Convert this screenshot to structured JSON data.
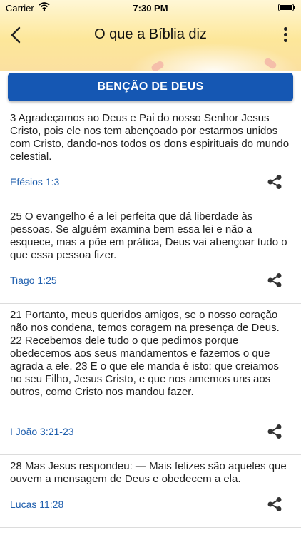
{
  "status_bar": {
    "carrier": "Carrier",
    "time": "7:30 PM"
  },
  "nav": {
    "title": "O que a Bíblia diz"
  },
  "section": {
    "label": "BENÇÃO DE DEUS"
  },
  "verses": [
    {
      "text": "3 Agradeçamos ao Deus e Pai do nosso Senhor Jesus Cristo, pois ele nos tem abençoado por estarmos unidos com Cristo, dando-nos todos os dons espirituais do mundo celestial.",
      "reference": "Efésios 1:3"
    },
    {
      "text": "25 O evangelho é a lei perfeita que dá liberdade às pessoas. Se alguém examina bem essa lei e não a esquece, mas a põe em prática, Deus vai abençoar tudo o que essa pessoa fizer.",
      "reference": "Tiago 1:25"
    },
    {
      "text": "21 Portanto, meus queridos amigos, se o nosso coração não nos condena, temos coragem na presença de Deus. 22 Recebemos dele tudo o que pedimos porque obedecemos aos seus mandamentos e fazemos o que agrada a ele. 23 E o que ele manda é isto: que creiamos no seu Filho, Jesus Cristo, e que nos amemos uns aos outros, como Cristo nos mandou fazer.",
      "reference": "I João 3:21-23"
    },
    {
      "text": "28 Mas Jesus respondeu: — Mais felizes são aqueles que ouvem a mensagem de Deus e obedecem a ela.",
      "reference": "Lucas 11:28"
    }
  ],
  "icons": {
    "back": "chevron-left-icon",
    "more": "more-vertical-icon",
    "share": "share-icon",
    "wifi": "wifi-icon",
    "battery": "battery-icon"
  },
  "colors": {
    "accent": "#1557b3",
    "reference": "#1f5fae",
    "header_bg": "#fde79a"
  }
}
